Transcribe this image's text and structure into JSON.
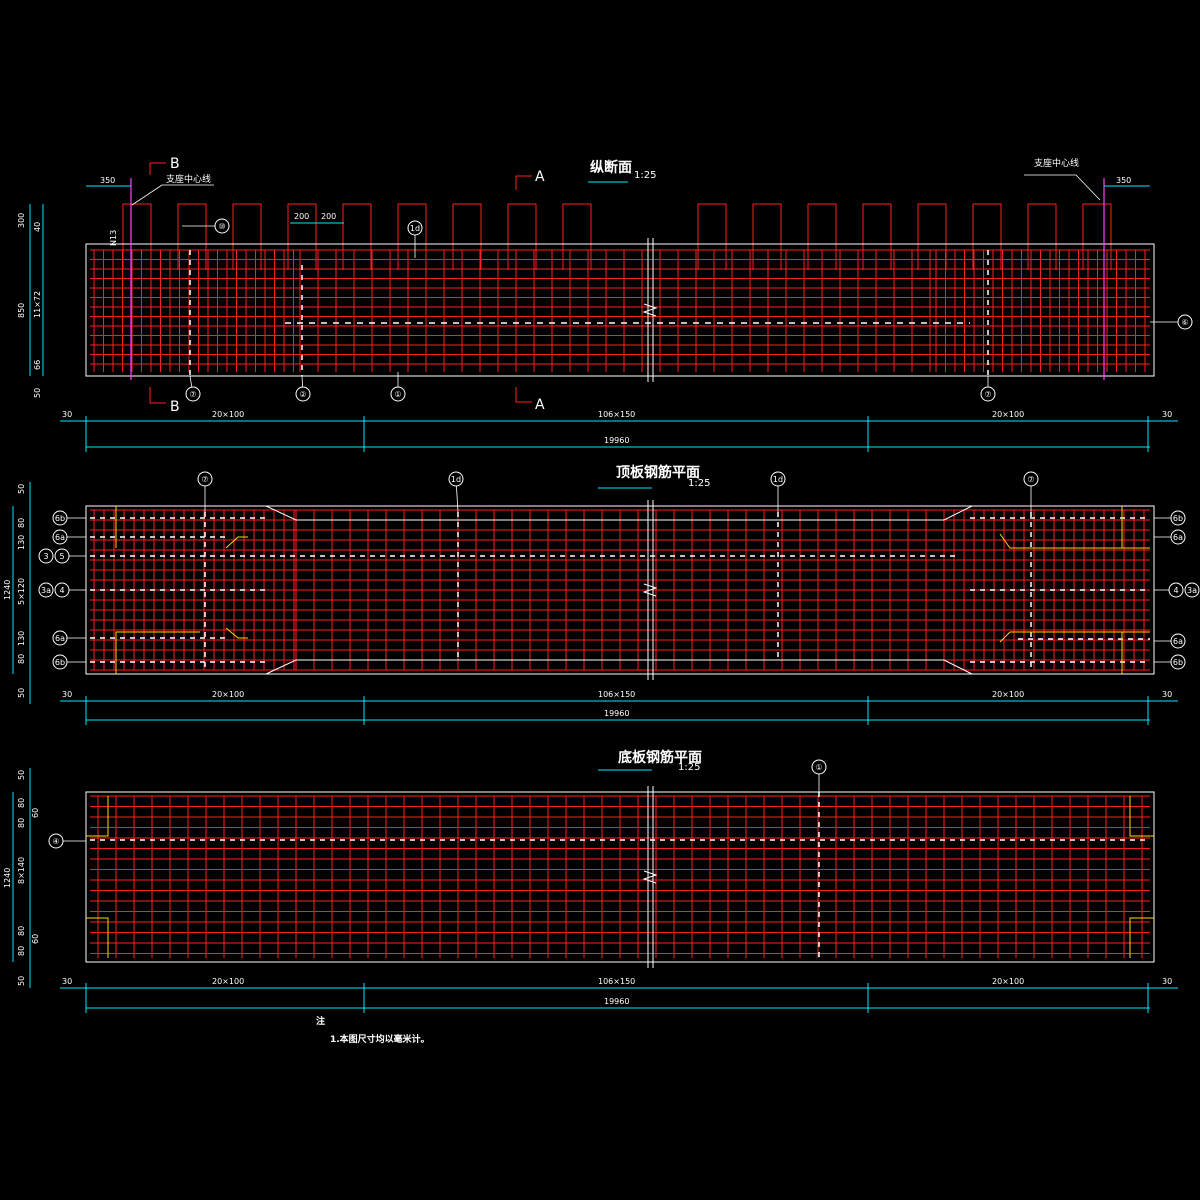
{
  "colors": {
    "background": "#000000",
    "rebar": "#ff2020",
    "outline": "#ffffff",
    "dim": "#00e5ff",
    "accent": "#ffd800",
    "support": "#ff40ff"
  },
  "views": [
    {
      "id": "elevation",
      "title": "纵断面",
      "scale": "1:25"
    },
    {
      "id": "top-slab",
      "title": "顶板钢筋平面",
      "scale": "1:25"
    },
    {
      "id": "bottom-slab",
      "title": "底板钢筋平面",
      "scale": "1:25"
    }
  ],
  "section_marks": {
    "b": "B",
    "a": "A"
  },
  "support_label": "支座中心线",
  "dims": {
    "ends": "30",
    "seg_left": "20×100",
    "seg_mid": "106×150",
    "seg_right": "20×100",
    "total": "19960",
    "end_offset": "350",
    "stirrup_a": "200",
    "stirrup_b": "200",
    "tag_n13": "N13",
    "elev_v": [
      "300",
      "40",
      "850",
      "11×72",
      "66",
      "50"
    ],
    "top_v": [
      "50",
      "80",
      "130",
      "1240",
      "5×120",
      "130",
      "80",
      "50"
    ],
    "bot_v": [
      "50",
      "80",
      "80",
      "60",
      "1240",
      "8×140",
      "80",
      "80",
      "60",
      "50"
    ]
  },
  "bubbles": {
    "elev": [
      "⑦",
      "②",
      "①",
      "⑦",
      "⑩",
      "1d",
      "⑥"
    ],
    "top": [
      "⑦",
      "1d",
      "1d",
      "⑦",
      "6b",
      "6a",
      "3",
      "5",
      "3a",
      "4",
      "6a",
      "6b",
      "6b",
      "6a",
      "4",
      "3a",
      "6a",
      "6b"
    ],
    "bot": [
      "①",
      "④"
    ]
  },
  "note": {
    "heading": "注",
    "text": "1.本图尺寸均以毫米计。"
  }
}
